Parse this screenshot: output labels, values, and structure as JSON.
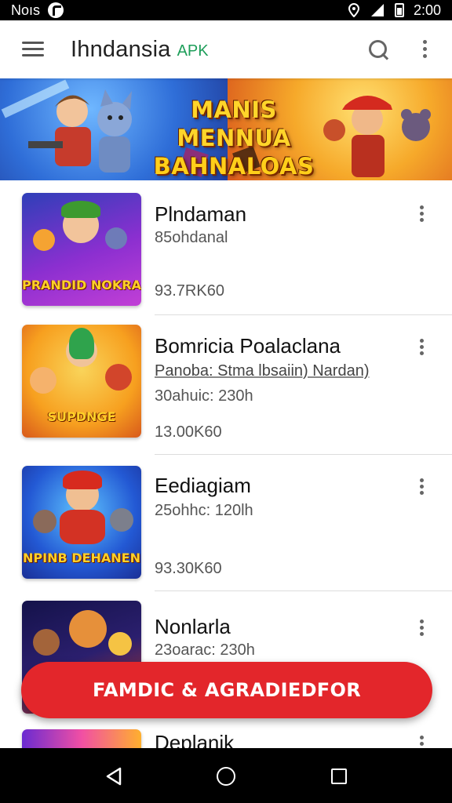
{
  "status_bar": {
    "left_text": "Noıs",
    "time": "2:00"
  },
  "app_bar": {
    "title": "Ihndansia",
    "badge": "APK"
  },
  "banner": {
    "title_line1": "MANIS MENNUA",
    "title_line2": "BAHNALOAS"
  },
  "apps": [
    {
      "title": "Plndaman",
      "subtitle": "85ohdanal",
      "meta": "",
      "size": "93.7RK60",
      "thumb_caption": "PRANDID NOKRA",
      "thumb_colors": [
        "#4b1fa8",
        "#c23fd6",
        "#ffb43c"
      ]
    },
    {
      "title": "Bomricia  Poalaclana",
      "subtitle": "Panoba: Stma lbsaiin) Nardan)",
      "meta": "30ahuic: 230h",
      "size": "13.00K60",
      "thumb_caption": "SUPDNGE",
      "thumb_colors": [
        "#f7a01f",
        "#f5c443",
        "#d8591b"
      ]
    },
    {
      "title": "Eediagiam",
      "subtitle": "",
      "meta": "25ohhc: 120lh",
      "size": "93.30K60",
      "thumb_caption": "NPINB DEHANEN",
      "thumb_colors": [
        "#1f4fd0",
        "#39a4f2",
        "#e23c2a"
      ]
    },
    {
      "title": "Nonlarla",
      "subtitle": "",
      "meta": "23oarac: 230h",
      "size": "",
      "thumb_caption": "",
      "thumb_colors": [
        "#1d1a5e",
        "#f39a1e",
        "#c0392b"
      ]
    },
    {
      "title": "Deplanik",
      "subtitle": "",
      "meta": "",
      "size": "",
      "thumb_caption": "",
      "thumb_colors": [
        "#6a2bd1",
        "#f14fa4",
        "#ffb02e"
      ]
    }
  ],
  "cta": {
    "label": "FAMDIC & AGRADIEDFOR"
  },
  "icons": [
    "menu-icon",
    "search-icon",
    "overflow-menu-icon",
    "nav-back-icon",
    "nav-home-icon",
    "nav-recents-icon"
  ],
  "colors": {
    "accent_red": "#e3262b",
    "badge_green": "#1e9e5a"
  }
}
